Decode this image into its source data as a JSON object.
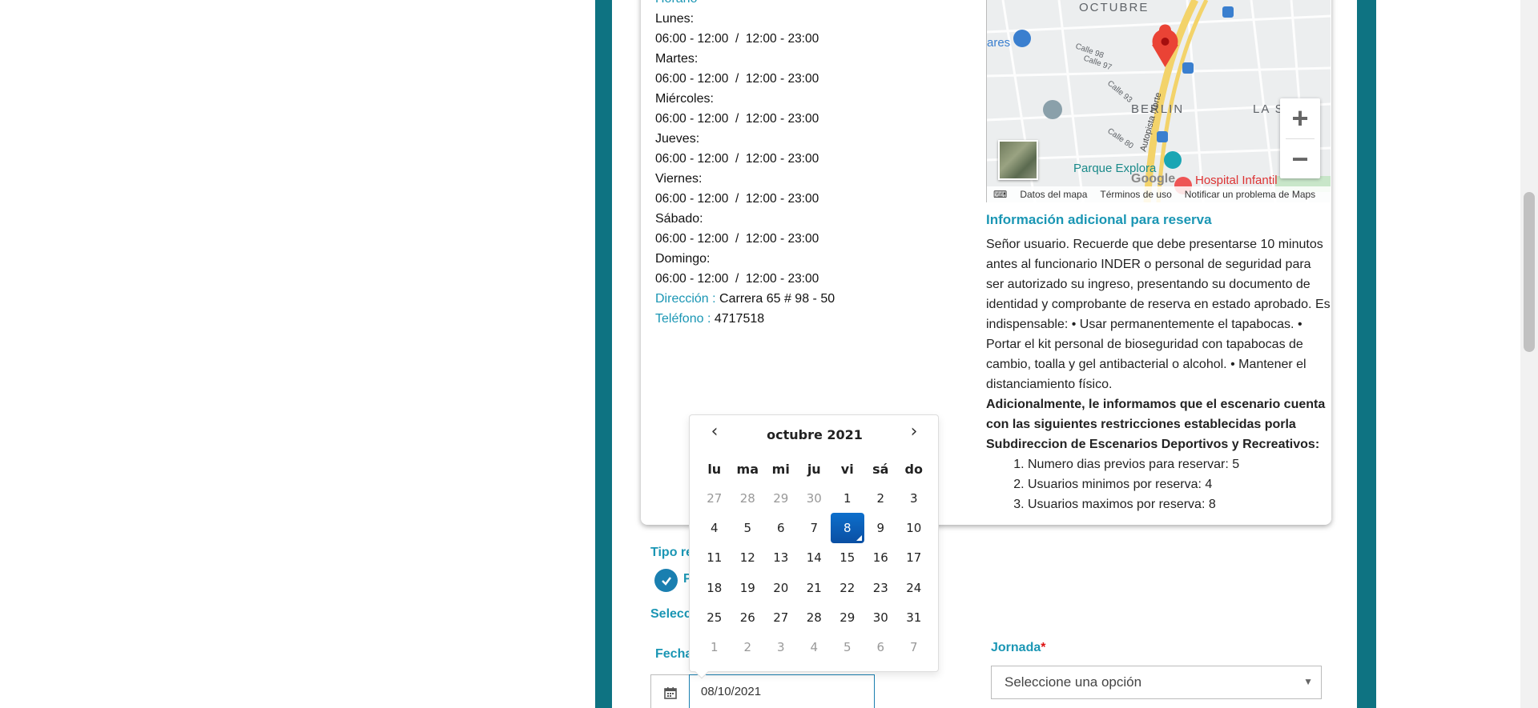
{
  "schedule": {
    "heading": "Horario",
    "days": [
      {
        "day": "Lunes:",
        "hours": "06:00 - 12:00  /  12:00 - 23:00"
      },
      {
        "day": "Martes:",
        "hours": "06:00 - 12:00  /  12:00 - 23:00"
      },
      {
        "day": "Miércoles:",
        "hours": "06:00 - 12:00  /  12:00 - 23:00"
      },
      {
        "day": "Jueves:",
        "hours": "06:00 - 12:00  /  12:00 - 23:00"
      },
      {
        "day": "Viernes:",
        "hours": "06:00 - 12:00  /  12:00 - 23:00"
      },
      {
        "day": "Sábado:",
        "hours": "06:00 - 12:00  /  12:00 - 23:00"
      },
      {
        "day": "Domingo:",
        "hours": "06:00 - 12:00  /  12:00 - 23:00"
      }
    ],
    "address_label": "Dirección :",
    "address_value": "Carrera 65 # 98 - 50",
    "phone_label": "Teléfono :",
    "phone_value": "4717518"
  },
  "map": {
    "labels": [
      "OCTUBRE",
      "BERLIN",
      "LA SA",
      "Parque Explora",
      "Hospital Infantil",
      "Autopista Norte",
      "Calle 98",
      "Calle 97",
      "Calle 93",
      "Calle 80",
      "ares",
      "Google"
    ],
    "zoom_in": "+",
    "zoom_out": "−",
    "attr_data": "Datos del mapa",
    "attr_terms": "Términos de uso",
    "attr_report": "Notificar un problema de Maps"
  },
  "info": {
    "title": "Información adicional para reserva",
    "body": "Señor usuario. Recuerde que debe presentarse 10 minutos antes al funcionario INDER o personal de seguridad para ser autorizado su ingreso, presentando su documento de identidad y comprobante de reserva en estado aprobado. Es indispensable: • Usar permanentemente el tapabocas. • Portar el kit personal de bioseguridad con tapabocas de cambio, toalla y gel antibacterial o alcohol. • Mantener el distanciamiento físico.",
    "bold": "Adicionalmente, le informamos que el escenario cuenta con las siguientes restricciones establecidas porla Subdireccion de Escenarios Deportivos y Recreativos:",
    "restrictions": [
      "Numero dias previos para reservar: 5",
      "Usuarios minimos por reserva: 4",
      "Usuarios maximos por reserva: 8"
    ]
  },
  "form": {
    "tipo_label": "Tipo re",
    "radio_text": "P",
    "select_label": "Selecc",
    "fecha_label": "Fecha",
    "jornada_label": "Jornada",
    "required_mark": "*",
    "jornada_value": "Seleccione una opción",
    "date_value": "08/10/2021"
  },
  "datepicker": {
    "prev": "‹",
    "next": "›",
    "month": "octubre 2021",
    "weekdays": [
      "lu",
      "ma",
      "mi",
      "ju",
      "vi",
      "sá",
      "do"
    ],
    "weeks": [
      [
        "27",
        "28",
        "29",
        "30",
        "1",
        "2",
        "3"
      ],
      [
        "4",
        "5",
        "6",
        "7",
        "8",
        "9",
        "10"
      ],
      [
        "11",
        "12",
        "13",
        "14",
        "15",
        "16",
        "17"
      ],
      [
        "18",
        "19",
        "20",
        "21",
        "22",
        "23",
        "24"
      ],
      [
        "25",
        "26",
        "27",
        "28",
        "29",
        "30",
        "31"
      ],
      [
        "1",
        "2",
        "3",
        "4",
        "5",
        "6",
        "7"
      ]
    ],
    "selected": "8"
  },
  "colors": {
    "teal_frame": "#0e7382",
    "accent": "#1a96b4",
    "selected_day": "#0d6fcc"
  }
}
